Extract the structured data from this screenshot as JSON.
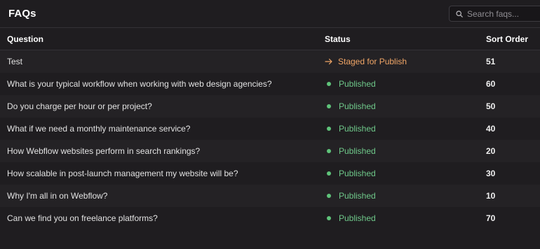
{
  "header": {
    "title": "FAQs",
    "search_placeholder": "Search faqs..."
  },
  "columns": {
    "question": "Question",
    "status": "Status",
    "sort_order": "Sort Order"
  },
  "colors": {
    "published": "#6fc98a",
    "staged": "#f0a566"
  },
  "rows": [
    {
      "question": "Test",
      "status": "Staged for Publish",
      "status_type": "staged",
      "sort_order": "51"
    },
    {
      "question": "What is your typical workflow when working with web design agencies?",
      "status": "Published",
      "status_type": "published",
      "sort_order": "60"
    },
    {
      "question": "Do you charge per hour or per project?",
      "status": "Published",
      "status_type": "published",
      "sort_order": "50"
    },
    {
      "question": "What if we need a monthly maintenance service?",
      "status": "Published",
      "status_type": "published",
      "sort_order": "40"
    },
    {
      "question": "How Webflow websites perform in search rankings?",
      "status": "Published",
      "status_type": "published",
      "sort_order": "20"
    },
    {
      "question": "How scalable in post-launch management my website will be?",
      "status": "Published",
      "status_type": "published",
      "sort_order": "30"
    },
    {
      "question": "Why I'm all in on Webflow?",
      "status": "Published",
      "status_type": "published",
      "sort_order": "10"
    },
    {
      "question": "Can we find you on freelance platforms?",
      "status": "Published",
      "status_type": "published",
      "sort_order": "70"
    }
  ]
}
